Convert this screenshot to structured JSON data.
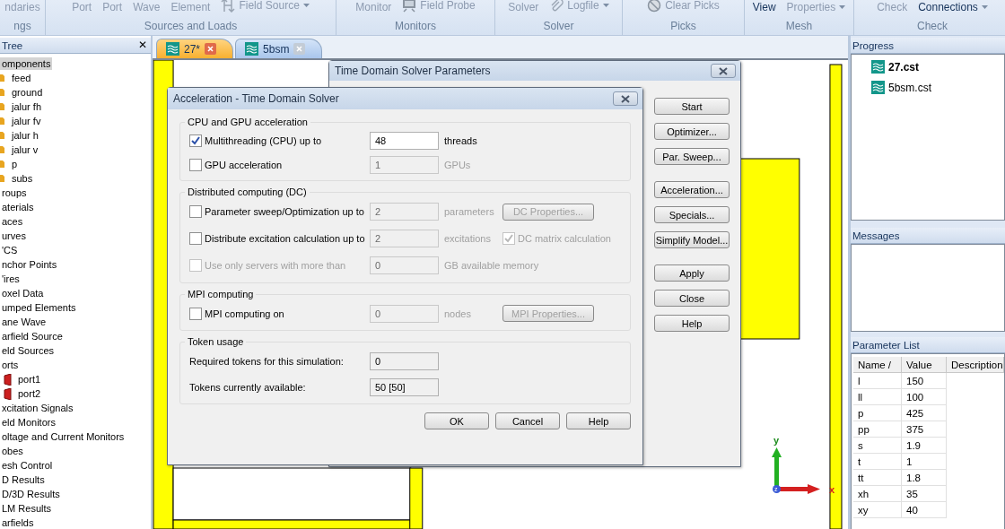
{
  "ribbon": {
    "groups": [
      {
        "label": "ngs",
        "items": [
          {
            "kind": "large",
            "text": "ndaries",
            "disabled": true
          }
        ]
      },
      {
        "label": "Sources and Loads",
        "items": [
          {
            "kind": "large",
            "text": "Port",
            "disabled": true
          },
          {
            "kind": "large",
            "text": "Port",
            "disabled": true
          },
          {
            "kind": "large",
            "text": "Wave",
            "disabled": true
          },
          {
            "kind": "large",
            "text": "Element",
            "disabled": true
          },
          {
            "kind": "small",
            "text": "Field Source",
            "disabled": true,
            "menu": true
          }
        ]
      },
      {
        "label": "Monitors",
        "items": [
          {
            "kind": "large",
            "text": "Monitor",
            "disabled": true
          },
          {
            "kind": "small",
            "text": "Field Probe",
            "disabled": true
          }
        ]
      },
      {
        "label": "Solver",
        "items": [
          {
            "kind": "large",
            "text": "Solver",
            "disabled": true
          },
          {
            "kind": "small",
            "text": "Logfile",
            "disabled": true,
            "menu": true
          }
        ]
      },
      {
        "label": "Picks",
        "items": [
          {
            "kind": "small",
            "text": "Clear Picks",
            "disabled": true
          }
        ]
      },
      {
        "label": "Mesh",
        "items": [
          {
            "kind": "large",
            "text": "View",
            "disabled": false
          },
          {
            "kind": "large",
            "text": "Properties",
            "disabled": true,
            "menu": true
          }
        ]
      },
      {
        "label": "Check",
        "items": [
          {
            "kind": "large",
            "text": "Check",
            "disabled": true
          },
          {
            "kind": "large",
            "text": "Connections",
            "disabled": false,
            "menu": true
          }
        ]
      }
    ]
  },
  "tree": {
    "title": "Tree",
    "close": "✕",
    "items": [
      {
        "label": "omponents",
        "selected": true,
        "children": [
          {
            "label": "feed",
            "selected": false
          },
          {
            "label": "ground",
            "selected": false
          },
          {
            "label": "jalur fh",
            "selected": false
          },
          {
            "label": "jalur fv",
            "selected": false
          },
          {
            "label": "jalur h",
            "selected": false
          },
          {
            "label": "jalur v",
            "selected": false
          },
          {
            "label": "p",
            "selected": false
          },
          {
            "label": "subs",
            "selected": false
          }
        ]
      },
      {
        "label": "roups",
        "selected": false
      },
      {
        "label": "aterials",
        "selected": false
      },
      {
        "label": "aces",
        "selected": false
      },
      {
        "label": "urves",
        "selected": false
      },
      {
        "label": "'CS",
        "selected": false
      },
      {
        "label": "nchor Points",
        "selected": false
      },
      {
        "label": "'ires",
        "selected": false
      },
      {
        "label": "oxel Data",
        "selected": false
      },
      {
        "label": "umped Elements",
        "selected": false
      },
      {
        "label": "ane Wave",
        "selected": false
      },
      {
        "label": "arfield Source",
        "selected": false
      },
      {
        "label": "eld Sources",
        "selected": false
      },
      {
        "label": "orts",
        "selected": false,
        "children": [
          {
            "label": "port1",
            "selected": false
          },
          {
            "label": "port2",
            "selected": false
          }
        ]
      },
      {
        "label": "xcitation Signals",
        "selected": false
      },
      {
        "label": "eld Monitors",
        "selected": false
      },
      {
        "label": "oltage and Current Monitors",
        "selected": false
      },
      {
        "label": "obes",
        "selected": false
      },
      {
        "label": "esh Control",
        "selected": false
      },
      {
        "label": "D Results",
        "selected": false
      },
      {
        "label": "D/3D Results",
        "selected": false
      },
      {
        "label": "LM Results",
        "selected": false
      },
      {
        "label": "arfields",
        "selected": false
      }
    ]
  },
  "tabs": [
    {
      "label": "27*",
      "selected": true
    },
    {
      "label": "5bsm",
      "selected": false
    }
  ],
  "canvas": {
    "axes": {
      "x": "x",
      "y": "y",
      "z": "z"
    }
  },
  "solver_dialog": {
    "title": "Time Domain Solver Parameters",
    "button_groups": [
      [
        "Start",
        "Optimizer...",
        "Par. Sweep..."
      ],
      [
        "Acceleration...",
        "Specials...",
        "Simplify Model..."
      ],
      [
        "Apply",
        "Close",
        "Help"
      ]
    ]
  },
  "accel_dialog": {
    "title": "Acceleration - Time Domain Solver",
    "groups": [
      {
        "title": "CPU and GPU acceleration",
        "rows": [
          {
            "kind": "check",
            "label": "Multithreading (CPU) up to",
            "checked": true,
            "disabled": false,
            "value": "48",
            "value_disabled": false,
            "unit": "threads"
          },
          {
            "kind": "check",
            "label": "GPU acceleration",
            "checked": false,
            "disabled": false,
            "value": "1",
            "value_disabled": true,
            "unit": "GPUs"
          }
        ]
      },
      {
        "title": "Distributed computing (DC)",
        "rows": [
          {
            "kind": "check",
            "label": "Parameter sweep/Optimization up to",
            "checked": false,
            "disabled": false,
            "value": "2",
            "value_disabled": true,
            "unit": "parameters",
            "action": {
              "label": "DC Properties...",
              "disabled": true
            }
          },
          {
            "kind": "check",
            "label": "Distribute excitation calculation up to",
            "checked": false,
            "disabled": false,
            "value": "2",
            "value_disabled": true,
            "unit": "excitations",
            "option": {
              "label": "DC matrix calculation",
              "checked": true,
              "disabled": true
            }
          },
          {
            "kind": "check",
            "label": "Use only servers with more than",
            "checked": false,
            "disabled": true,
            "value": "0",
            "value_disabled": true,
            "unit": "GB available memory"
          }
        ]
      },
      {
        "title": "MPI computing",
        "rows": [
          {
            "kind": "check",
            "label": "MPI computing on",
            "checked": false,
            "disabled": false,
            "value": "0",
            "value_disabled": true,
            "unit": "nodes",
            "action": {
              "label": "MPI Properties...",
              "disabled": true
            }
          }
        ]
      },
      {
        "title": "Token usage",
        "rows": [
          {
            "kind": "readout",
            "label": "Required tokens for this simulation:",
            "value": "0"
          },
          {
            "kind": "readout",
            "label": "Tokens currently available:",
            "value": "50 [50]"
          }
        ]
      }
    ],
    "buttons": [
      "OK",
      "Cancel",
      "Help"
    ]
  },
  "progress": {
    "title": "Progress",
    "items": [
      {
        "label": "27.cst",
        "active": true
      },
      {
        "label": "5bsm.cst",
        "active": false
      }
    ]
  },
  "messages": {
    "title": "Messages"
  },
  "parameters": {
    "title": "Parameter List",
    "columns": [
      "Name /",
      "Value",
      "Description"
    ],
    "rows": [
      {
        "name": "l",
        "value": "150"
      },
      {
        "name": "ll",
        "value": "100"
      },
      {
        "name": "p",
        "value": "425"
      },
      {
        "name": "pp",
        "value": "375"
      },
      {
        "name": "s",
        "value": "1.9"
      },
      {
        "name": "t",
        "value": "1"
      },
      {
        "name": "tt",
        "value": "1.8"
      },
      {
        "name": "xh",
        "value": "35"
      },
      {
        "name": "xy",
        "value": "40"
      }
    ]
  }
}
